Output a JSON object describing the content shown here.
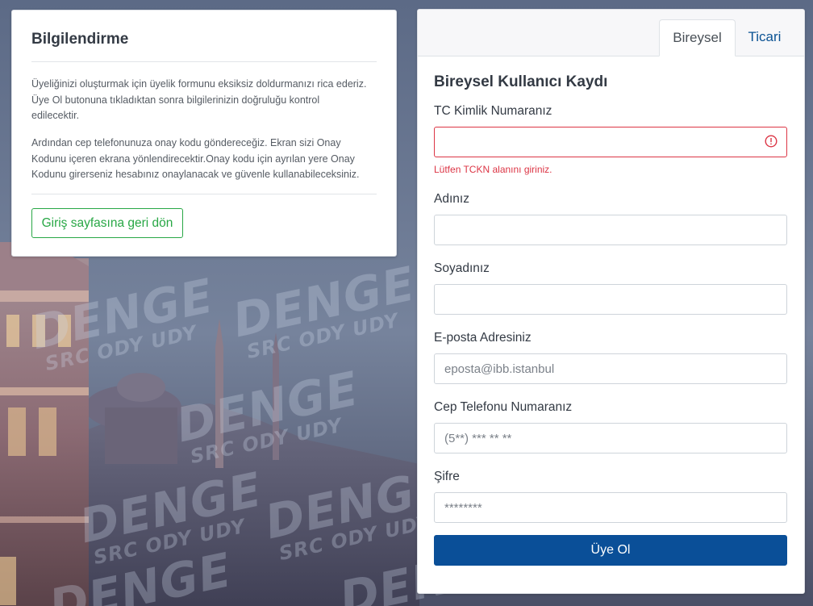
{
  "info_card": {
    "title": "Bilgilendirme",
    "paragraph_1": "Üyeliğinizi oluşturmak için üyelik formunu eksiksiz doldurmanızı rica ederiz. Üye Ol butonuna tıkladıktan sonra bilgilerinizin doğruluğu kontrol edilecektir.",
    "paragraph_2": "Ardından cep telefonunuza onay kodu göndereceğiz. Ekran sizi Onay Kodunu içeren ekrana yönlendirecektir.Onay kodu için ayrılan yere Onay Kodunu girerseniz hesabınız onaylanacak ve güvenle kullanabileceksiniz.",
    "back_button_label": "Giriş sayfasına geri dön"
  },
  "background": {
    "watermark_big": "DENGE",
    "watermark_small": "SRC ODY UDY"
  },
  "tabs": [
    {
      "label": "Bireysel",
      "active": true
    },
    {
      "label": "Ticari",
      "active": false
    }
  ],
  "form": {
    "title": "Bireysel Kullanıcı Kaydı",
    "fields": {
      "tckn": {
        "label": "TC Kimlik Numaranız",
        "value": "",
        "placeholder": "",
        "error": "Lütfen TCKN alanını giriniz."
      },
      "ad": {
        "label": "Adınız",
        "value": "",
        "placeholder": ""
      },
      "soyad": {
        "label": "Soyadınız",
        "value": "",
        "placeholder": ""
      },
      "email": {
        "label": "E-posta Adresiniz",
        "value": "",
        "placeholder": "eposta@ibb.istanbul"
      },
      "telefon": {
        "label": "Cep Telefonu Numaranız",
        "value": "",
        "placeholder": "(5**) *** ** **"
      },
      "sifre": {
        "label": "Şifre",
        "value": "",
        "placeholder": "********"
      }
    },
    "submit_label": "Üye Ol"
  },
  "colors": {
    "primary": "#0a4f98",
    "success": "#28a745",
    "danger": "#dc3545",
    "link": "#0b5394"
  },
  "icons": {
    "tckn_error": "exclamation-circle-icon"
  }
}
